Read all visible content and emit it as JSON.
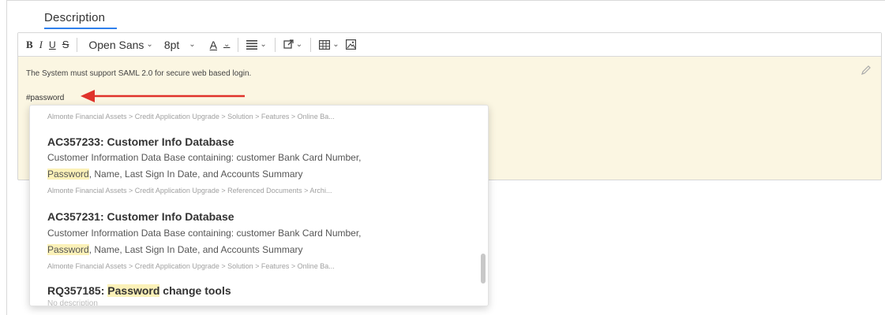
{
  "tab": {
    "label": "Description"
  },
  "toolbar": {
    "bold": "B",
    "italic": "I",
    "underline": "U",
    "strike": "S",
    "font_family": "Open Sans",
    "font_size": "8pt",
    "font_color": "A",
    "chevron": "∨"
  },
  "editor": {
    "text_line": "The System must support SAML 2.0 for secure web based login.",
    "mention_query": "#password"
  },
  "dropdown": {
    "top_path": "Almonte Financial Assets > Credit Application Upgrade > Solution > Features > Online Ba...",
    "items": [
      {
        "id_title": "AC357233: Customer Info Database",
        "desc_line1": "Customer Information Data Base containing: customer Bank Card Number,",
        "desc_highlight": "Password",
        "desc_line2_rest": ", Name, Last Sign In Date, and Accounts Summary",
        "path": "Almonte Financial Assets > Credit Application Upgrade > Referenced Documents > Archi..."
      },
      {
        "id_title": "AC357231: Customer Info Database",
        "desc_line1": "Customer Information Data Base containing: customer Bank Card Number,",
        "desc_highlight": "Password",
        "desc_line2_rest": ", Name, Last Sign In Date, and Accounts Summary",
        "path": "Almonte Financial Assets > Credit Application Upgrade > Solution > Features > Online Ba..."
      },
      {
        "id_prefix": "RQ357185: ",
        "title_highlight": "Password",
        "title_rest": " change tools",
        "faded": "No description"
      }
    ]
  },
  "colors": {
    "accent": "#2f80ed",
    "editor_bg": "#fbf6e2",
    "highlight": "#fbf1b8",
    "arrow": "#e0332b"
  }
}
